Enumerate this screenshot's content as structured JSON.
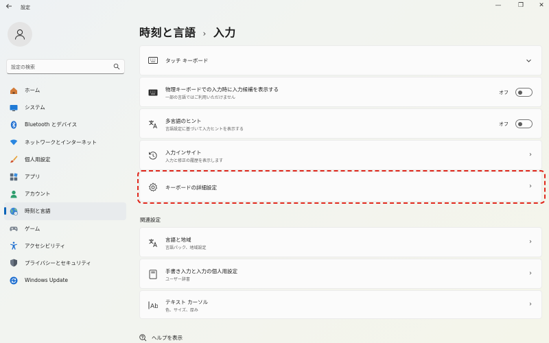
{
  "window": {
    "title": "設定",
    "back_icon": "arrow-left-icon",
    "minimize_glyph": "—",
    "maximize_glyph": "❐",
    "close_glyph": "✕"
  },
  "sidebar": {
    "search_placeholder": "設定の検索",
    "items": [
      {
        "label": "ホーム",
        "icon": "home-icon",
        "active": false
      },
      {
        "label": "システム",
        "icon": "system-icon",
        "active": false
      },
      {
        "label": "Bluetooth とデバイス",
        "icon": "bluetooth-icon",
        "active": false
      },
      {
        "label": "ネットワークとインターネット",
        "icon": "wifi-icon",
        "active": false
      },
      {
        "label": "個人用設定",
        "icon": "brush-icon",
        "active": false
      },
      {
        "label": "アプリ",
        "icon": "apps-icon",
        "active": false
      },
      {
        "label": "アカウント",
        "icon": "account-icon",
        "active": false
      },
      {
        "label": "時刻と言語",
        "icon": "globe-clock-icon",
        "active": true
      },
      {
        "label": "ゲーム",
        "icon": "gamepad-icon",
        "active": false
      },
      {
        "label": "アクセシビリティ",
        "icon": "accessibility-icon",
        "active": false
      },
      {
        "label": "プライバシーとセキュリティ",
        "icon": "shield-icon",
        "active": false
      },
      {
        "label": "Windows Update",
        "icon": "update-icon",
        "active": false
      }
    ]
  },
  "breadcrumb": {
    "parent": "時刻と言語",
    "separator": "›",
    "current": "入力"
  },
  "cards": {
    "touch_keyboard": {
      "title": "タッチ キーボード"
    },
    "physical_keyboard": {
      "title": "物理キーボードでの入力時に入力候補を表示する",
      "subtitle": "一部の言語ではご利用いただけません",
      "toggle_label": "オフ"
    },
    "multilingual": {
      "title": "多言語のヒント",
      "subtitle": "言語設定に基づいて入力ヒントを表示する",
      "toggle_label": "オフ"
    },
    "typing_insights": {
      "title": "入力インサイト",
      "subtitle": "入力と修正の履歴を表示します"
    },
    "advanced_keyboard": {
      "title": "キーボードの詳細設定"
    }
  },
  "related": {
    "heading": "関連設定",
    "items": [
      {
        "title": "言語と地域",
        "subtitle": "言語パック、地域設定"
      },
      {
        "title": "手書き入力と入力の個人用設定",
        "subtitle": "ユーザー辞書"
      },
      {
        "title": "テキスト カーソル",
        "subtitle": "色、サイズ、厚み"
      }
    ]
  },
  "help": {
    "label": "ヘルプを表示"
  },
  "colors": {
    "accent": "#0a63b8",
    "highlight": "#e0261b"
  }
}
